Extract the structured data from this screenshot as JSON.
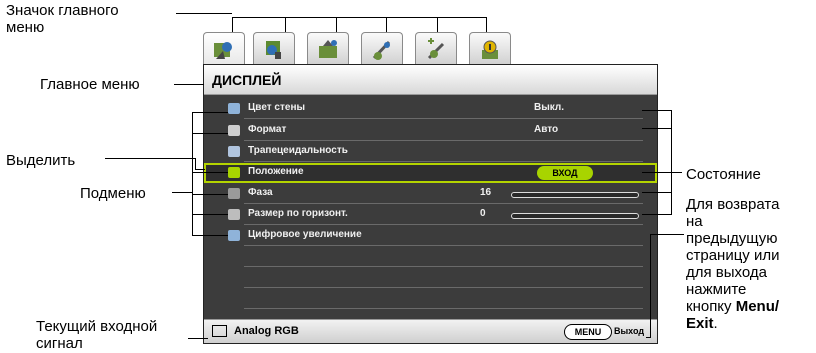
{
  "annotations": {
    "main_menu_icon": [
      "Значок главного",
      "меню"
    ],
    "main_menu": "Главное меню",
    "highlight": "Выделить",
    "submenu": "Подменю",
    "current_input": [
      "Текущий входной",
      "сигнал"
    ],
    "status": "Состояние",
    "back_hint": [
      "Для возврата",
      "на",
      "предыдущую",
      "страницу или",
      "для выхода",
      "нажмите",
      "кнопку ",
      "Menu/",
      "Exit",
      "."
    ]
  },
  "menu": {
    "title": "ДИСПЛЕЙ",
    "tab_icons": [
      "display-tab-icon",
      "picture-tab-icon",
      "source-tab-icon",
      "system-setup-tab-icon",
      "advanced-setup-tab-icon",
      "information-tab-icon"
    ],
    "items": [
      {
        "label": "Цвет стены",
        "value": "Выкл.",
        "icon_color": "#8fb3d9"
      },
      {
        "label": "Формат",
        "value": "Авто",
        "icon_color": "#cfcfcf"
      },
      {
        "label": "Трапецеидальность",
        "value": "",
        "icon_color": "#b0c4de"
      },
      {
        "label": "Положение",
        "value": "ВХОД",
        "icon_color": "#a8d400"
      },
      {
        "label": "Фаза",
        "value": "16",
        "slider": 0.0,
        "icon_color": "#9a9a9a"
      },
      {
        "label": "Размер по горизонт.",
        "value": "0",
        "slider": 0.0,
        "icon_color": "#bdbdbd"
      },
      {
        "label": "Цифровое увеличение",
        "value": "",
        "icon_color": "#8fb3d9"
      }
    ],
    "source": "Analog RGB",
    "menu_button": "MENU",
    "exit_label": "Выход"
  },
  "colors": {
    "highlight": "#b4d400",
    "enter_button": "#a8d400",
    "menu_bg": "#3c3c3c"
  }
}
